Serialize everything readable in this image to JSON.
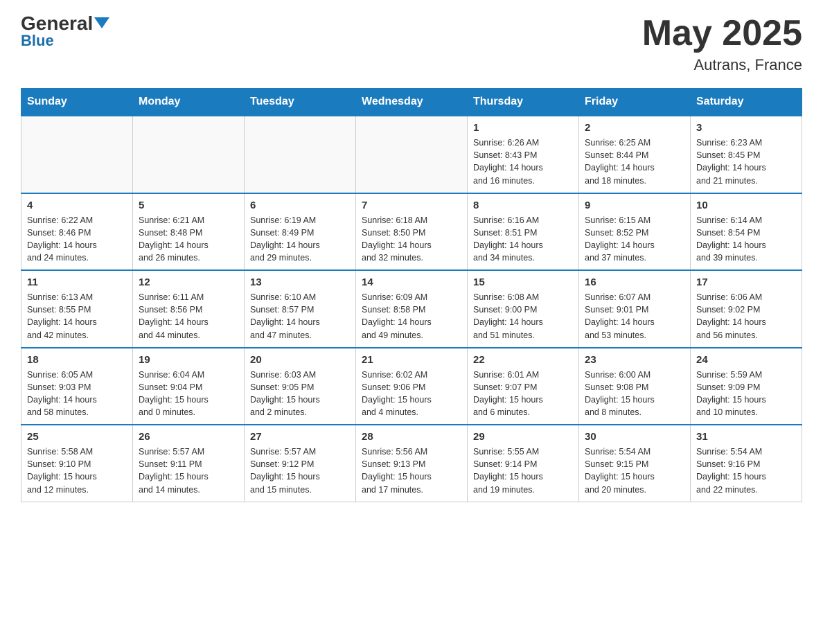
{
  "header": {
    "logo_general": "General",
    "logo_blue": "Blue",
    "month_year": "May 2025",
    "location": "Autrans, France"
  },
  "days_of_week": [
    "Sunday",
    "Monday",
    "Tuesday",
    "Wednesday",
    "Thursday",
    "Friday",
    "Saturday"
  ],
  "weeks": [
    [
      {
        "day": "",
        "info": ""
      },
      {
        "day": "",
        "info": ""
      },
      {
        "day": "",
        "info": ""
      },
      {
        "day": "",
        "info": ""
      },
      {
        "day": "1",
        "info": "Sunrise: 6:26 AM\nSunset: 8:43 PM\nDaylight: 14 hours\nand 16 minutes."
      },
      {
        "day": "2",
        "info": "Sunrise: 6:25 AM\nSunset: 8:44 PM\nDaylight: 14 hours\nand 18 minutes."
      },
      {
        "day": "3",
        "info": "Sunrise: 6:23 AM\nSunset: 8:45 PM\nDaylight: 14 hours\nand 21 minutes."
      }
    ],
    [
      {
        "day": "4",
        "info": "Sunrise: 6:22 AM\nSunset: 8:46 PM\nDaylight: 14 hours\nand 24 minutes."
      },
      {
        "day": "5",
        "info": "Sunrise: 6:21 AM\nSunset: 8:48 PM\nDaylight: 14 hours\nand 26 minutes."
      },
      {
        "day": "6",
        "info": "Sunrise: 6:19 AM\nSunset: 8:49 PM\nDaylight: 14 hours\nand 29 minutes."
      },
      {
        "day": "7",
        "info": "Sunrise: 6:18 AM\nSunset: 8:50 PM\nDaylight: 14 hours\nand 32 minutes."
      },
      {
        "day": "8",
        "info": "Sunrise: 6:16 AM\nSunset: 8:51 PM\nDaylight: 14 hours\nand 34 minutes."
      },
      {
        "day": "9",
        "info": "Sunrise: 6:15 AM\nSunset: 8:52 PM\nDaylight: 14 hours\nand 37 minutes."
      },
      {
        "day": "10",
        "info": "Sunrise: 6:14 AM\nSunset: 8:54 PM\nDaylight: 14 hours\nand 39 minutes."
      }
    ],
    [
      {
        "day": "11",
        "info": "Sunrise: 6:13 AM\nSunset: 8:55 PM\nDaylight: 14 hours\nand 42 minutes."
      },
      {
        "day": "12",
        "info": "Sunrise: 6:11 AM\nSunset: 8:56 PM\nDaylight: 14 hours\nand 44 minutes."
      },
      {
        "day": "13",
        "info": "Sunrise: 6:10 AM\nSunset: 8:57 PM\nDaylight: 14 hours\nand 47 minutes."
      },
      {
        "day": "14",
        "info": "Sunrise: 6:09 AM\nSunset: 8:58 PM\nDaylight: 14 hours\nand 49 minutes."
      },
      {
        "day": "15",
        "info": "Sunrise: 6:08 AM\nSunset: 9:00 PM\nDaylight: 14 hours\nand 51 minutes."
      },
      {
        "day": "16",
        "info": "Sunrise: 6:07 AM\nSunset: 9:01 PM\nDaylight: 14 hours\nand 53 minutes."
      },
      {
        "day": "17",
        "info": "Sunrise: 6:06 AM\nSunset: 9:02 PM\nDaylight: 14 hours\nand 56 minutes."
      }
    ],
    [
      {
        "day": "18",
        "info": "Sunrise: 6:05 AM\nSunset: 9:03 PM\nDaylight: 14 hours\nand 58 minutes."
      },
      {
        "day": "19",
        "info": "Sunrise: 6:04 AM\nSunset: 9:04 PM\nDaylight: 15 hours\nand 0 minutes."
      },
      {
        "day": "20",
        "info": "Sunrise: 6:03 AM\nSunset: 9:05 PM\nDaylight: 15 hours\nand 2 minutes."
      },
      {
        "day": "21",
        "info": "Sunrise: 6:02 AM\nSunset: 9:06 PM\nDaylight: 15 hours\nand 4 minutes."
      },
      {
        "day": "22",
        "info": "Sunrise: 6:01 AM\nSunset: 9:07 PM\nDaylight: 15 hours\nand 6 minutes."
      },
      {
        "day": "23",
        "info": "Sunrise: 6:00 AM\nSunset: 9:08 PM\nDaylight: 15 hours\nand 8 minutes."
      },
      {
        "day": "24",
        "info": "Sunrise: 5:59 AM\nSunset: 9:09 PM\nDaylight: 15 hours\nand 10 minutes."
      }
    ],
    [
      {
        "day": "25",
        "info": "Sunrise: 5:58 AM\nSunset: 9:10 PM\nDaylight: 15 hours\nand 12 minutes."
      },
      {
        "day": "26",
        "info": "Sunrise: 5:57 AM\nSunset: 9:11 PM\nDaylight: 15 hours\nand 14 minutes."
      },
      {
        "day": "27",
        "info": "Sunrise: 5:57 AM\nSunset: 9:12 PM\nDaylight: 15 hours\nand 15 minutes."
      },
      {
        "day": "28",
        "info": "Sunrise: 5:56 AM\nSunset: 9:13 PM\nDaylight: 15 hours\nand 17 minutes."
      },
      {
        "day": "29",
        "info": "Sunrise: 5:55 AM\nSunset: 9:14 PM\nDaylight: 15 hours\nand 19 minutes."
      },
      {
        "day": "30",
        "info": "Sunrise: 5:54 AM\nSunset: 9:15 PM\nDaylight: 15 hours\nand 20 minutes."
      },
      {
        "day": "31",
        "info": "Sunrise: 5:54 AM\nSunset: 9:16 PM\nDaylight: 15 hours\nand 22 minutes."
      }
    ]
  ]
}
